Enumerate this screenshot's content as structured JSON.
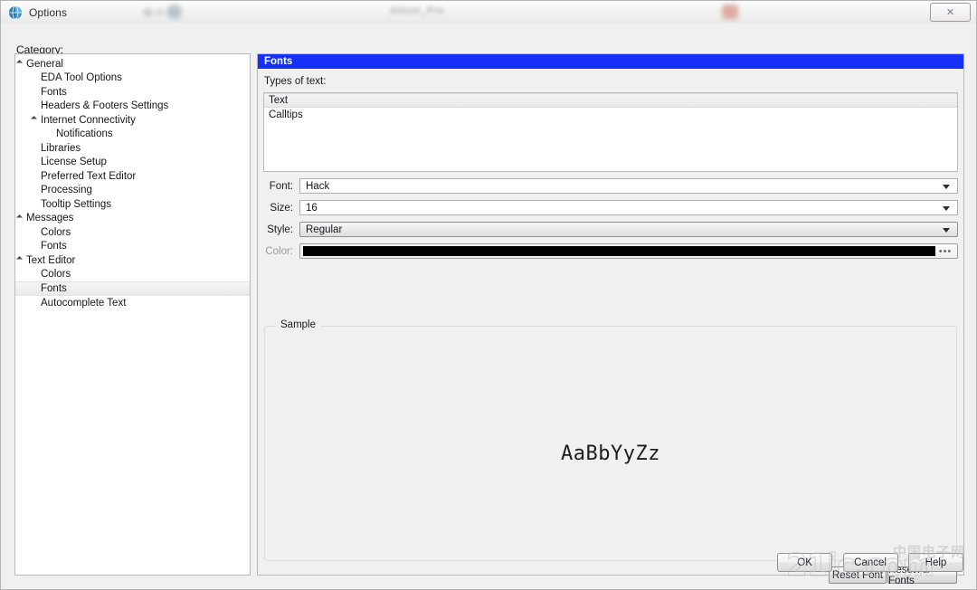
{
  "window": {
    "title": "Options",
    "title_icon": "globe-icon",
    "close_label": "✕",
    "blurred_title_text": "Altium_Pro"
  },
  "category": {
    "label": "Category:",
    "tree": [
      {
        "label": "General",
        "indent": 0,
        "expander": true,
        "selected": false
      },
      {
        "label": "EDA Tool Options",
        "indent": 1,
        "expander": false,
        "selected": false
      },
      {
        "label": "Fonts",
        "indent": 1,
        "expander": false,
        "selected": false
      },
      {
        "label": "Headers & Footers Settings",
        "indent": 1,
        "expander": false,
        "selected": false
      },
      {
        "label": "Internet Connectivity",
        "indent": 1,
        "expander": true,
        "selected": false
      },
      {
        "label": "Notifications",
        "indent": 2,
        "expander": false,
        "selected": false
      },
      {
        "label": "Libraries",
        "indent": 1,
        "expander": false,
        "selected": false
      },
      {
        "label": "License Setup",
        "indent": 1,
        "expander": false,
        "selected": false
      },
      {
        "label": "Preferred Text Editor",
        "indent": 1,
        "expander": false,
        "selected": false
      },
      {
        "label": "Processing",
        "indent": 1,
        "expander": false,
        "selected": false
      },
      {
        "label": "Tooltip Settings",
        "indent": 1,
        "expander": false,
        "selected": false
      },
      {
        "label": "Messages",
        "indent": 0,
        "expander": true,
        "selected": false
      },
      {
        "label": "Colors",
        "indent": 1,
        "expander": false,
        "selected": false
      },
      {
        "label": "Fonts",
        "indent": 1,
        "expander": false,
        "selected": false
      },
      {
        "label": "Text Editor",
        "indent": 0,
        "expander": true,
        "selected": false
      },
      {
        "label": "Colors",
        "indent": 1,
        "expander": false,
        "selected": false
      },
      {
        "label": "Fonts",
        "indent": 1,
        "expander": false,
        "selected": true
      },
      {
        "label": "Autocomplete Text",
        "indent": 1,
        "expander": false,
        "selected": false
      }
    ]
  },
  "panel": {
    "header_title": "Fonts",
    "header_color": "#1431f5",
    "types_label": "Types of text:",
    "types_list": [
      {
        "label": "Text",
        "selected": true
      },
      {
        "label": "Calltips",
        "selected": false
      }
    ],
    "fields": {
      "font": {
        "label": "Font:",
        "value": "Hack",
        "arrow_icon": "chevron-down-icon"
      },
      "size": {
        "label": "Size:",
        "value": "16",
        "arrow_icon": "chevron-down-icon"
      },
      "style": {
        "label": "Style:",
        "value": "Regular",
        "arrow_icon": "chevron-down-icon"
      },
      "color": {
        "label": "Color:",
        "value": "#000000",
        "ellipsis_label": "•••"
      }
    },
    "sample": {
      "legend": "Sample",
      "preview_text": "AaBbYyZz"
    },
    "reset_font_label": "Reset Font",
    "reset_all_label": "Reset All Fonts"
  },
  "footer": {
    "ok_label": "OK",
    "cancel_label": "Cancel",
    "help_label": "Help"
  },
  "watermark": {
    "main": "21ic.com",
    "sub": "中国电子网"
  }
}
